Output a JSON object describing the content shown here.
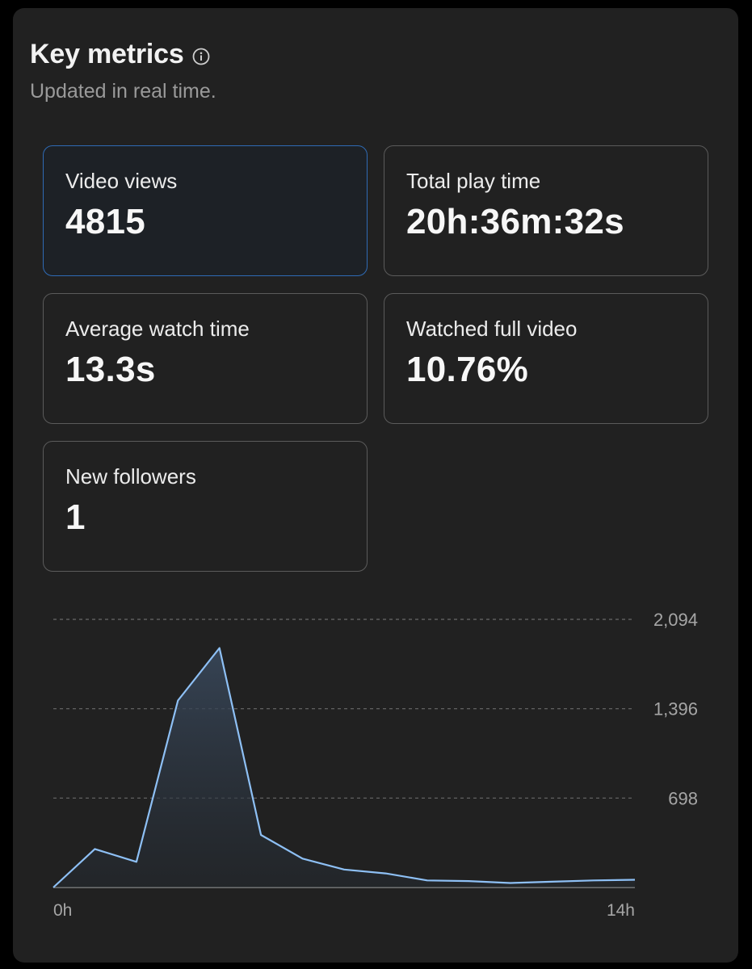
{
  "header": {
    "title": "Key metrics",
    "subtitle": "Updated in real time."
  },
  "metrics": [
    {
      "label": "Video views",
      "value": "4815"
    },
    {
      "label": "Total play time",
      "value": "20h:36m:32s"
    },
    {
      "label": "Average watch time",
      "value": "13.3s"
    },
    {
      "label": "Watched full video",
      "value": "10.76%"
    },
    {
      "label": "New followers",
      "value": "1"
    }
  ],
  "colors": {
    "background": "#212121",
    "active_border": "#2f6bb5",
    "line": "#8ec0f5"
  },
  "chart_data": {
    "type": "area",
    "x": [
      0,
      1,
      2,
      3,
      4,
      5,
      6,
      7,
      8,
      9,
      10,
      11,
      12,
      13,
      14
    ],
    "values": [
      0,
      300,
      200,
      1460,
      1870,
      410,
      225,
      140,
      110,
      55,
      50,
      35,
      45,
      55,
      60
    ],
    "x_tick_labels": [
      "0h",
      "14h"
    ],
    "y_tick_labels": [
      "2,094",
      "1,396",
      "698"
    ],
    "y_ticks": [
      2094,
      1396,
      698
    ],
    "ylim": [
      0,
      2094
    ],
    "grid": true
  }
}
